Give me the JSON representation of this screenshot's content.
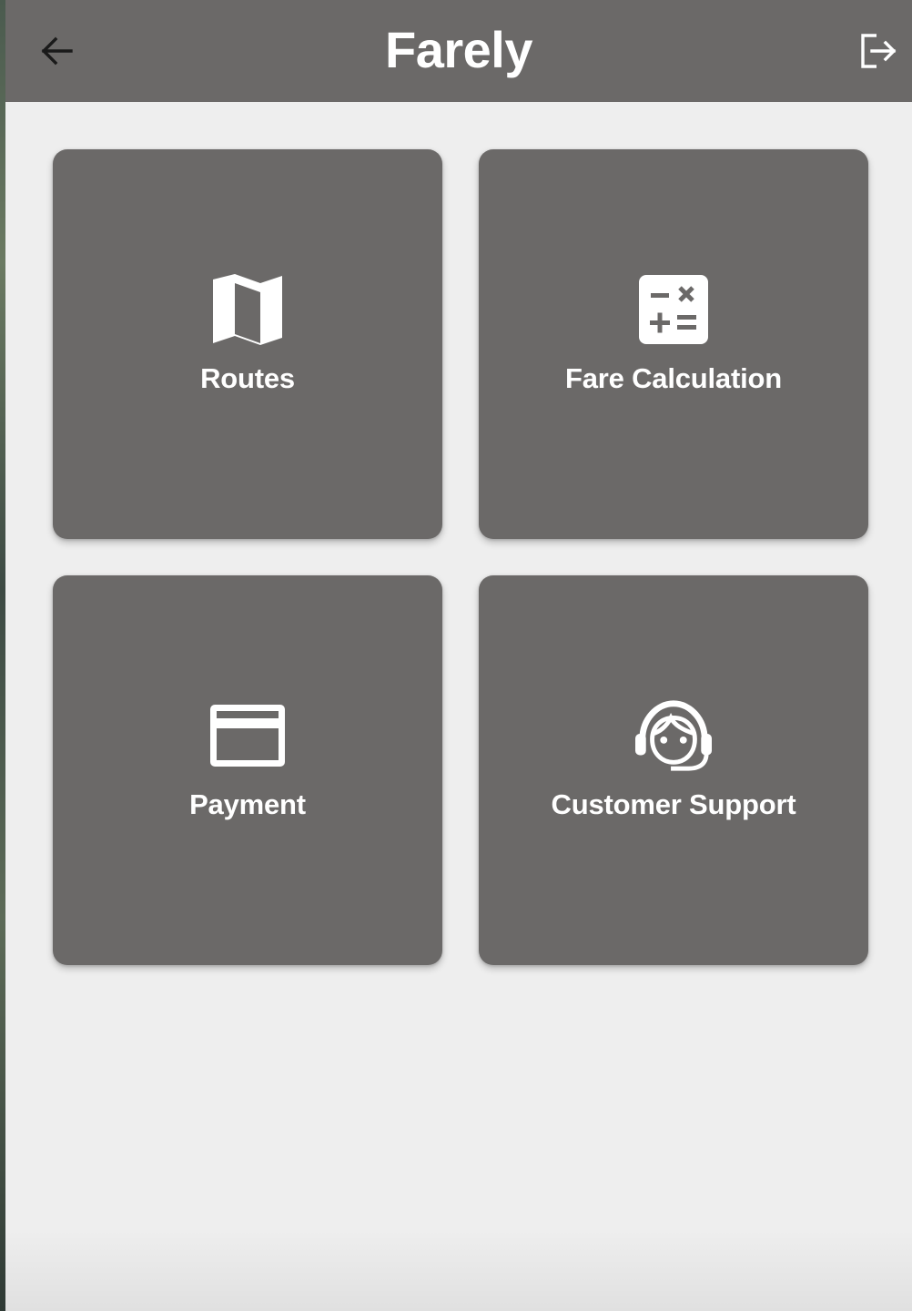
{
  "app_bar": {
    "title": "Farely",
    "back_icon": "arrow-back-icon",
    "logout_icon": "logout-icon",
    "background_color": "#6b6968"
  },
  "tiles": [
    {
      "label": "Routes",
      "icon": "map-icon"
    },
    {
      "label": "Fare Calculation",
      "icon": "calculator-icon"
    },
    {
      "label": "Payment",
      "icon": "credit-card-icon"
    },
    {
      "label": "Customer Support",
      "icon": "support-agent-icon"
    }
  ],
  "colors": {
    "tile_background": "#6b6968",
    "page_background": "#eeeeee",
    "text": "#ffffff"
  }
}
